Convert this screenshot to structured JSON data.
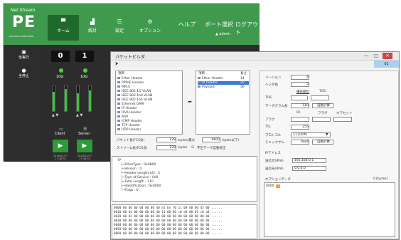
{
  "brand": {
    "line1": "Net Stream",
    "logo": "PE",
    "line3": "PROTOCOL EMULATOR"
  },
  "nav": [
    {
      "icon": "▀",
      "label": "ホーム"
    },
    {
      "icon": "▟",
      "label": "統計"
    },
    {
      "icon": "☰",
      "label": "設定"
    },
    {
      "icon": "⚙",
      "label": "オプション"
    }
  ],
  "topnav": [
    "ヘルプ",
    "ポート選択",
    "ログアウト"
  ],
  "admin": "▲ admin",
  "sidebar": [
    {
      "icon": "▣",
      "label": "全実行"
    },
    {
      "icon": "●",
      "label": "全停止"
    }
  ],
  "ports": [
    {
      "num": "0",
      "speed": "10G",
      "meters": [
        0.75,
        0.85
      ],
      "client_icon": "▭",
      "client": "Client",
      "date": "2016/02/27",
      "time": "17:48:34"
    },
    {
      "num": "1",
      "speed": "10G",
      "meters": [
        0.7,
        0.8
      ],
      "client_icon": "☰",
      "client": "Server",
      "date": "2016/02/27",
      "time": "17:48:33"
    }
  ],
  "play_icon": "▶",
  "arrows": "▲ ▼",
  "window": {
    "title": "パケットビルダ",
    "min": "—",
    "max": "□",
    "close": "✕",
    "tool": "⮞",
    "hl": "01"
  },
  "list1": {
    "header": "項目",
    "rows": [
      "Ether Header",
      "PPPoE Header",
      "MPLS",
      "IEEE 802.1Q VLAN",
      "IEEE 802.1ad VLAN",
      "IEEE 802.1ah VLAN",
      "Ethernet OAM",
      "IP Header",
      "IPv6 Header",
      "ARP",
      "ICMP Header",
      "TCP Header",
      "UDP Header"
    ]
  },
  "list2": {
    "h1": "項目",
    "h2": "長さ",
    "rows": [
      {
        "n": "Ether Header",
        "v": "14"
      },
      {
        "n": "IP Header",
        "v": "20"
      },
      {
        "n": "Payload",
        "v": "36"
      }
    ]
  },
  "move_arrow": "➡",
  "frame": {
    "l": "パケット長(FCS含)",
    "v": "128",
    "u": "bytes(最大",
    "mx": "9600",
    "u2": "bytes以下)"
  },
  "stream": {
    "l": "ストリーム長(FCS含)",
    "v": "128",
    "u": "bytes",
    "cb": "☑",
    "cbl": "不正データ自動修正"
  },
  "tree": [
    "IP",
    "├─EtherType : 0x0800",
    "├─Version : 4",
    "├─Header Length(x4) : 5",
    "├─Type of Service : 0x0",
    "├─Total Length : 110",
    "├─Identification : 0x0000",
    "└─Flags : 0"
  ],
  "hex": [
    "0000  00 00 00 00 00 00 40 e2 be 70 1c 08 00 00 45 00  ......",
    "0010  00 6e 00 00 00 00 40 11 00 00 c0 a8 00 01 c0 a8  ......",
    "0020  00 02 00 00 00 00 00 00 00 00 00 00 00 00 00 00  ......",
    "0030  00 00 00 00 00 00 00 00 00 00 00 00 00 00 00 00  ......",
    "0040  00 00 00 00 00 00 00 00 00 00 00 00 00 00 00 00  ......",
    "0050  00 00 00 00 00 00 00 00 00 00 00 00 00 00 00 00  ......",
    "0060  00 00 00 00 00 00 00 00 00 00 00 00 00 00 00 00  ......"
  ],
  "props": {
    "version_l": "バージョン",
    "version_v": "4",
    "hlen_l": "ヘッダ長",
    "hlen_v": "5",
    "prec_l": "優先順位",
    "tos_sub": "TOS",
    "tos_l": "TOS",
    "tl_l": "データグラム長",
    "tl_v": "110",
    "calc": "自動計算",
    "id_sub": "ID",
    "fl_sub": "フラグ",
    "off_sub": "オフセット",
    "flag_l": "フラグ",
    "ttl_l": "TTL",
    "ttl_v": "255",
    "proto_l": "プロトコル",
    "proto_v": "17 (UDP)",
    "proto_caret": "▼",
    "cs_l": "チェックサム",
    "cs_v": "0xe4",
    "addr_hdr": "IPアドレス",
    "src_l": "送信元(IP/A)",
    "src_v": "192.168.0.1",
    "dst_l": "送信先(IP/A)",
    "dst_v": "0.0.0.0",
    "opt_l": "オプションデータ",
    "opt_u": "0 [bytes]",
    "opt_v": "0000"
  }
}
